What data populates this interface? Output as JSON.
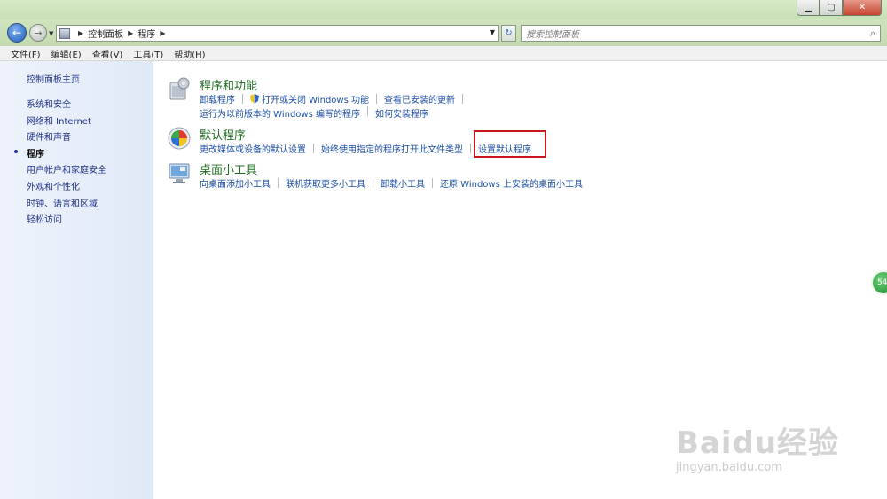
{
  "window": {
    "minimize_glyph": "▁",
    "maximize_glyph": "▢",
    "close_glyph": "✕"
  },
  "nav": {
    "back_glyph": "←",
    "forward_glyph": "→",
    "breadcrumb": [
      "控制面板",
      "程序"
    ],
    "refresh_glyph": "↻",
    "search_placeholder": "搜索控制面板"
  },
  "menubar": [
    "文件(F)",
    "编辑(E)",
    "查看(V)",
    "工具(T)",
    "帮助(H)"
  ],
  "sidebar": {
    "home": "控制面板主页",
    "items": [
      "系统和安全",
      "网络和 Internet",
      "硬件和声音",
      "程序",
      "用户帐户和家庭安全",
      "外观和个性化",
      "时钟、语言和区域",
      "轻松访问"
    ],
    "current": "程序"
  },
  "groups": {
    "programs": {
      "title": "程序和功能",
      "links": [
        "卸载程序",
        "打开或关闭 Windows 功能",
        "查看已安装的更新"
      ],
      "links2": [
        "运行为以前版本的 Windows 编写的程序",
        "如何安装程序"
      ]
    },
    "defaults": {
      "title": "默认程序",
      "links": [
        "更改媒体或设备的默认设置",
        "始终使用指定的程序打开此文件类型",
        "设置默认程序"
      ]
    },
    "gadgets": {
      "title": "桌面小工具",
      "links": [
        "向桌面添加小工具",
        "联机获取更多小工具",
        "卸载小工具",
        "还原 Windows 上安装的桌面小工具"
      ]
    }
  },
  "overlay": {
    "page_badge": "54",
    "watermark_logo": "Baidu经验",
    "watermark_site": "jingyan.baidu.com"
  },
  "colors": {
    "link": "#1b4fa5",
    "group_title": "#1f6e23",
    "highlight": "#c8181d"
  }
}
